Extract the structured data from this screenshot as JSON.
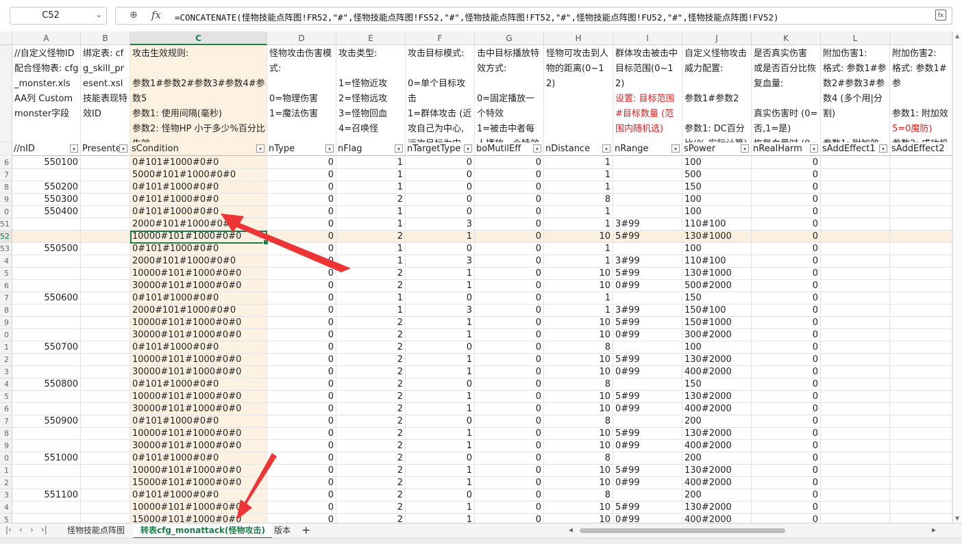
{
  "formula_bar": {
    "name_box": "C52",
    "formula": "=CONCATENATE(怪物技能点阵图!FR52,\"#\",怪物技能点阵图!FS52,\"#\",怪物技能点阵图!FT52,\"#\",怪物技能点阵图!FU52,\"#\",怪物技能点阵图!FV52)"
  },
  "columns": [
    "A",
    "B",
    "C",
    "D",
    "E",
    "F",
    "G",
    "H",
    "I",
    "J",
    "K",
    "L",
    ""
  ],
  "description_row": {
    "A": "//自定义怪物ID 配合怪物表: cfg_monster.xls AA列 Custommonster字段",
    "B": "绑定表: cfg_skill_present.xsl 技能表现特效ID",
    "C": "攻击生效规则:\n\n参数1#参数2#参数3#参数4#参数5\n参数1: 使用间隔(毫秒)\n参数2: 怪物HP 小于多少%百分比生效",
    "D": "怪物攻击伤害模式:\n\n0=物理伤害\n1=魔法伤害",
    "E": "攻击类型:\n\n1=怪物近攻\n2=怪物远攻\n3=怪物回血\n4=召唤怪",
    "F": "攻击目标模式:\n\n0=单个目标攻击\n1=群体攻击 (近攻自己为中心, 远攻目标为中心)",
    "G": "击中目标播放特效方式:\n\n0=固定播放一个特效\n1=被击中者每人播放一个特效",
    "H": "怪物可攻击到人物的距离(0~12)",
    "I_black": "群体攻击被击中目标范围(0~12)",
    "I_red": "设置: 目标范围#目标数量 (范围内随机选)",
    "J": "自定义怪物攻击威力配置:\n\n参数1#参数2\n\n参数1: DC百分比(% 实际计算)",
    "K": "是否真实伤害 或是否百分比恢复血量:\n\n真实伤害时 (0=否,1=是)\n恢复血量时 (0=",
    "L": "附加伤害1:\n格式: 参数1#参数2#参数3#参数4 (多个用|分割)\n\n参数1: 附加效",
    "M_black1": "附加伤害2:\n格式: 参数1#参\n\n参数1: 附加效",
    "M_red": "5=0魔防)",
    "M_black2": "参数2: 成功机率\n参数3: 时间(秒"
  },
  "field_row": [
    "//nID",
    "Presente",
    "sCondition",
    "nType",
    "nFlag",
    "nTargetType",
    "boMutilEff",
    "nDistance",
    "nRange",
    "sPower",
    "nRealHarm",
    "sAddEffect1",
    "sAddEffect2"
  ],
  "row_numbers": [
    "6",
    "7",
    "8",
    "9",
    "0",
    "51",
    "52",
    "53",
    "4",
    "5",
    "6",
    "7",
    "8",
    "9",
    "0",
    "1",
    "2",
    "3",
    "4",
    "5",
    "6",
    "7",
    "8",
    "9",
    "0",
    "1",
    "2",
    "3",
    "4",
    "5"
  ],
  "rows": [
    [
      "550100",
      "",
      "0#101#1000#0#0",
      "0",
      "1",
      "0",
      "0",
      "1",
      "",
      "100",
      "0"
    ],
    [
      "",
      "",
      "5000#101#1000#0#0",
      "0",
      "1",
      "0",
      "0",
      "1",
      "",
      "500",
      "0"
    ],
    [
      "550200",
      "",
      "0#101#1000#0#0",
      "0",
      "1",
      "0",
      "0",
      "1",
      "",
      "150",
      "0"
    ],
    [
      "550300",
      "",
      "0#101#1000#0#0",
      "0",
      "2",
      "0",
      "0",
      "8",
      "",
      "100",
      "0"
    ],
    [
      "550400",
      "",
      "0#101#1000#0#0",
      "0",
      "1",
      "0",
      "0",
      "1",
      "",
      "100",
      "0"
    ],
    [
      "",
      "",
      "2000#101#1000#0#0",
      "0",
      "1",
      "3",
      "0",
      "1",
      "3#99",
      "110#100",
      "0"
    ],
    [
      "",
      "",
      "10000#101#1000#0#0",
      "0",
      "2",
      "1",
      "0",
      "10",
      "5#99",
      "130#1000",
      "0"
    ],
    [
      "550500",
      "",
      "0#101#1000#0#0",
      "0",
      "1",
      "0",
      "0",
      "1",
      "",
      "100",
      "0"
    ],
    [
      "",
      "",
      "2000#101#1000#0#0",
      "0",
      "1",
      "3",
      "0",
      "1",
      "3#99",
      "110#100",
      "0"
    ],
    [
      "",
      "",
      "10000#101#1000#0#0",
      "0",
      "2",
      "1",
      "0",
      "10",
      "5#99",
      "130#1000",
      "0"
    ],
    [
      "",
      "",
      "30000#101#1000#0#0",
      "0",
      "2",
      "1",
      "0",
      "10",
      "0#99",
      "500#2000",
      "0"
    ],
    [
      "550600",
      "",
      "0#101#1000#0#0",
      "0",
      "1",
      "0",
      "0",
      "1",
      "",
      "150",
      "0"
    ],
    [
      "",
      "",
      "2000#101#1000#0#0",
      "0",
      "1",
      "3",
      "0",
      "1",
      "3#99",
      "150#100",
      "0"
    ],
    [
      "",
      "",
      "10000#101#1000#0#0",
      "0",
      "2",
      "1",
      "0",
      "10",
      "5#99",
      "150#1000",
      "0"
    ],
    [
      "",
      "",
      "30000#101#1000#0#0",
      "0",
      "2",
      "1",
      "0",
      "10",
      "0#99",
      "300#2000",
      "0"
    ],
    [
      "550700",
      "",
      "0#101#1000#0#0",
      "0",
      "2",
      "0",
      "0",
      "8",
      "",
      "100",
      "0"
    ],
    [
      "",
      "",
      "10000#101#1000#0#0",
      "0",
      "2",
      "1",
      "0",
      "10",
      "5#99",
      "130#2000",
      "0"
    ],
    [
      "",
      "",
      "30000#101#1000#0#0",
      "0",
      "2",
      "1",
      "0",
      "10",
      "0#99",
      "400#2000",
      "0"
    ],
    [
      "550800",
      "",
      "0#101#1000#0#0",
      "0",
      "2",
      "0",
      "0",
      "8",
      "",
      "150",
      "0"
    ],
    [
      "",
      "",
      "10000#101#1000#0#0",
      "0",
      "2",
      "1",
      "0",
      "10",
      "5#99",
      "130#2000",
      "0"
    ],
    [
      "",
      "",
      "30000#101#1000#0#0",
      "0",
      "2",
      "1",
      "0",
      "10",
      "0#99",
      "400#2000",
      "0"
    ],
    [
      "550900",
      "",
      "0#101#1000#0#0",
      "0",
      "2",
      "0",
      "0",
      "8",
      "",
      "200",
      "0"
    ],
    [
      "",
      "",
      "10000#101#1000#0#0",
      "0",
      "2",
      "1",
      "0",
      "10",
      "5#99",
      "130#2000",
      "0"
    ],
    [
      "",
      "",
      "30000#101#1000#0#0",
      "0",
      "2",
      "1",
      "0",
      "10",
      "0#99",
      "400#2000",
      "0"
    ],
    [
      "551000",
      "",
      "0#101#1000#0#0",
      "0",
      "2",
      "0",
      "0",
      "8",
      "",
      "200",
      "0"
    ],
    [
      "",
      "",
      "10000#101#1000#0#0",
      "0",
      "2",
      "1",
      "0",
      "10",
      "5#99",
      "130#2000",
      "0"
    ],
    [
      "",
      "",
      "15000#101#1000#0#0",
      "0",
      "2",
      "1",
      "0",
      "10",
      "0#99",
      "400#2000",
      "0"
    ],
    [
      "551100",
      "",
      "0#101#1000#0#0",
      "0",
      "2",
      "0",
      "0",
      "8",
      "",
      "200",
      "0"
    ],
    [
      "",
      "",
      "10000#101#1000#0#0",
      "0",
      "2",
      "1",
      "0",
      "10",
      "5#99",
      "130#2000",
      "0"
    ],
    [
      "",
      "",
      "15000#101#1000#0#0",
      "0",
      "2",
      "1",
      "0",
      "10",
      "0#99",
      "400#2000",
      "0"
    ]
  ],
  "sheet_tabs": [
    "怪物技能点阵图",
    "转表cfg_monattack(怪物攻击)",
    "版本"
  ],
  "active_tab": "转表cfg_monattack(怪物攻击)",
  "colors": {
    "accent": "#1e7b4a",
    "selected_column": "#fdf2e2",
    "annotation_arrow": "#ee3434",
    "red_text": "#e02020"
  }
}
